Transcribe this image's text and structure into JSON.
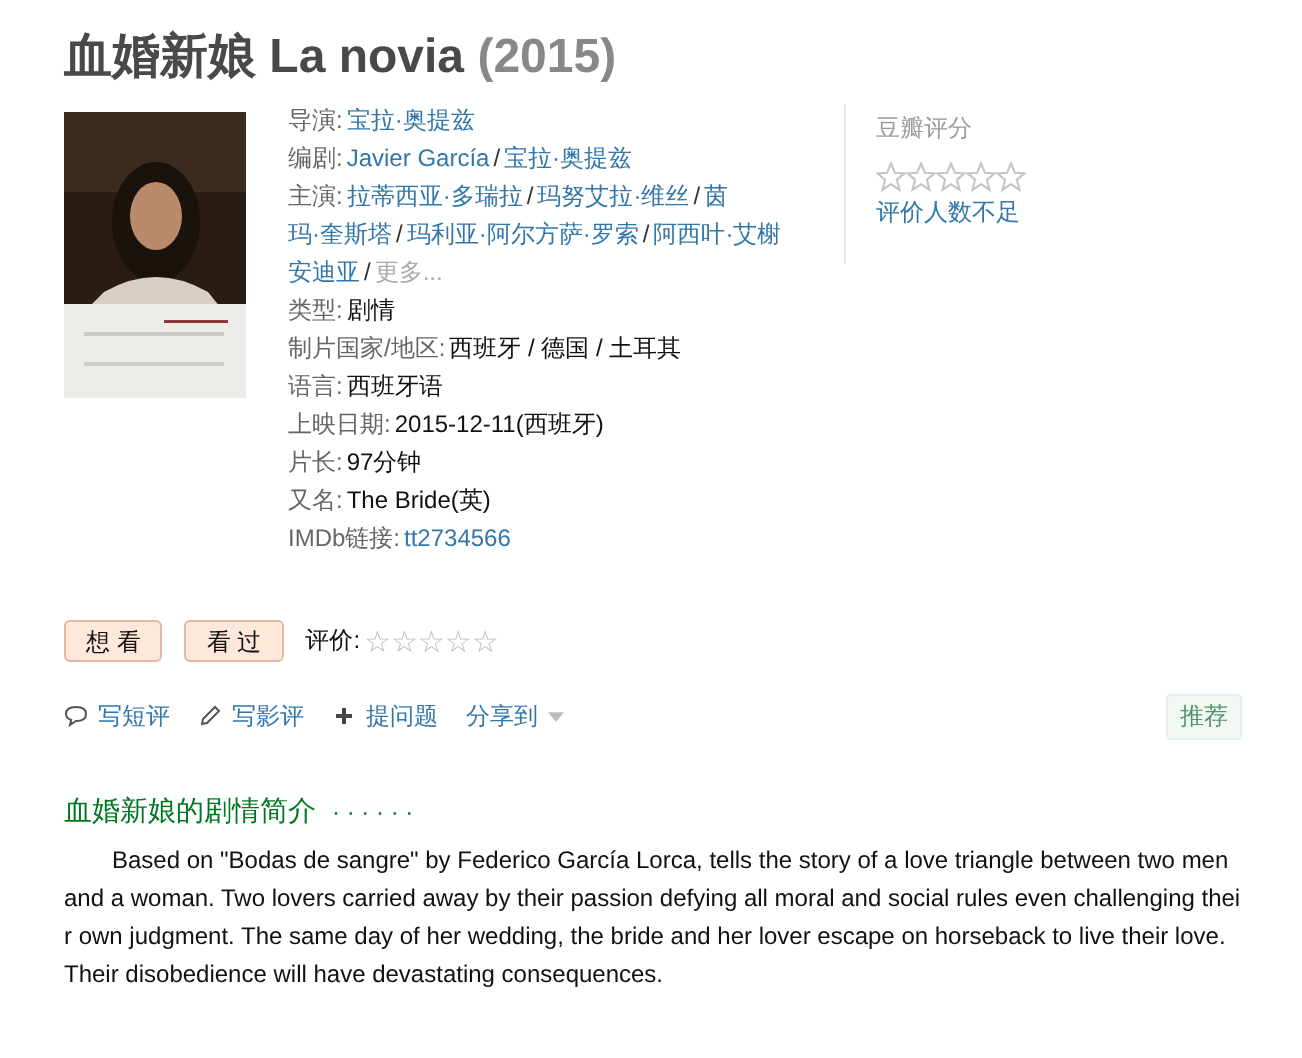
{
  "title": {
    "name": "血婚新娘 La novia",
    "year": "(2015)"
  },
  "poster": {
    "kind": "picture"
  },
  "info": [
    {
      "label": "导演:",
      "values": [
        {
          "text": "宝拉·奥提兹",
          "kind": "link"
        }
      ]
    },
    {
      "label": "编剧:",
      "values": [
        {
          "text": "Javier García",
          "kind": "link"
        },
        {
          "text": "/",
          "kind": "sep"
        },
        {
          "text": "宝拉·奥提兹",
          "kind": "link"
        }
      ]
    },
    {
      "label": "主演:",
      "values": [
        {
          "text": "拉蒂西亚·多瑞拉",
          "kind": "link"
        },
        {
          "text": "/",
          "kind": "sep"
        },
        {
          "text": "玛努艾拉·维丝",
          "kind": "link"
        },
        {
          "text": "/",
          "kind": "sep"
        },
        {
          "text": "茵",
          "kind": "link"
        }
      ]
    },
    {
      "values": [
        {
          "text": "玛·奎斯塔",
          "kind": "link"
        },
        {
          "text": "/",
          "kind": "sep"
        },
        {
          "text": "玛利亚·阿尔方萨·罗索",
          "kind": "link"
        },
        {
          "text": "/",
          "kind": "sep"
        },
        {
          "text": "阿西叶·艾榭",
          "kind": "link"
        }
      ]
    },
    {
      "values": [
        {
          "text": "安迪亚",
          "kind": "link"
        },
        {
          "text": "/",
          "kind": "sep"
        },
        {
          "text": "更多...",
          "kind": "more"
        }
      ]
    },
    {
      "label": "类型:",
      "values": [
        {
          "text": "剧情",
          "kind": "plain"
        }
      ]
    },
    {
      "label": "制片国家/地区:",
      "values": [
        {
          "text": "西班牙 / 德国 / 土耳其",
          "kind": "plain"
        }
      ]
    },
    {
      "label": "语言:",
      "values": [
        {
          "text": "西班牙语",
          "kind": "plain"
        }
      ]
    },
    {
      "label": "上映日期:",
      "values": [
        {
          "text": "2015-12-11(西班牙)",
          "kind": "plain"
        }
      ]
    },
    {
      "label": "片长:",
      "values": [
        {
          "text": "97分钟",
          "kind": "plain"
        }
      ]
    },
    {
      "label": "又名:",
      "values": [
        {
          "text": "The Bride(英)",
          "kind": "plain"
        }
      ]
    },
    {
      "label": "IMDb链接:",
      "values": [
        {
          "text": "tt2734566",
          "kind": "link"
        }
      ]
    }
  ],
  "rating": {
    "title": "豆瓣评分",
    "stars": 0,
    "note": "评价人数不足"
  },
  "buttons": [
    "想 看",
    "看 过"
  ],
  "my_rating": {
    "label": "评价:",
    "stars": 0
  },
  "actions": [
    {
      "label": "写短评",
      "kind": "comment"
    },
    {
      "label": "写影评",
      "kind": "pencil"
    },
    {
      "label": "提问题",
      "kind": "plus"
    },
    {
      "label": "分享到",
      "kind": "share"
    }
  ],
  "recommend": "推荐",
  "synopsis": {
    "heading": "血婚新娘的剧情简介",
    "dots": "· · · · · ·",
    "text": "Based on \"Bodas de sangre\" by Federico García Lorca, tells the story of a love triangle between two men and a woman. Two lovers carried away by their passion defying all moral and social rules even challenging their own judgment. The same day of her wedding, the bride and her lover escape on horseback to live their love. Their disobedience will have devastating consequences."
  }
}
